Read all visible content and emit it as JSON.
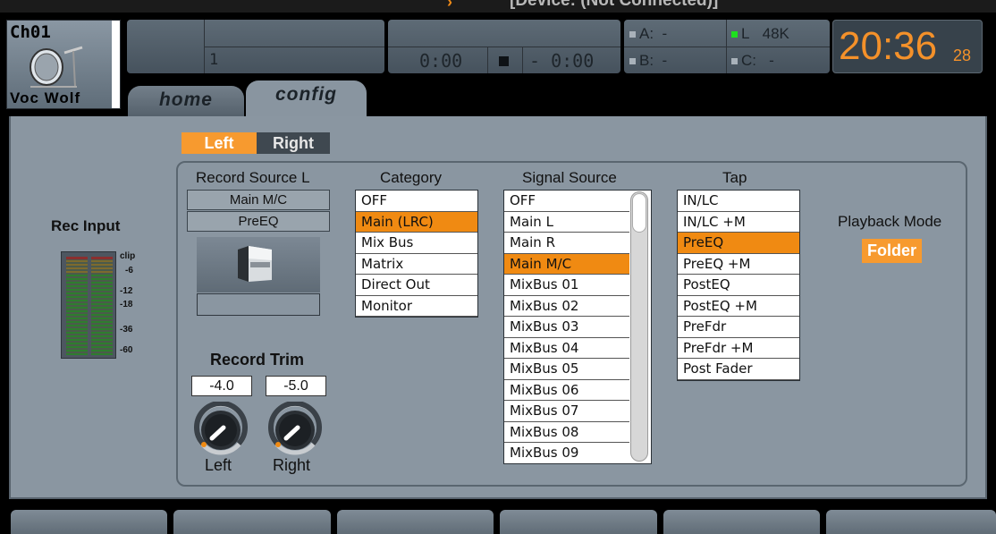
{
  "app": {
    "titlebar_text": "[Device: (Not Connected)]"
  },
  "channel": {
    "id": "Ch01",
    "name": "Voc Wolf",
    "icon": "drum-kit-icon"
  },
  "top": {
    "scene_number": "1",
    "transport": {
      "time": "0:00",
      "remaining": "- 0:00",
      "stop_icon": "stop-square-icon"
    },
    "indicators": [
      {
        "key": "A:",
        "value": "-",
        "active": false
      },
      {
        "key": "L",
        "value": "48K",
        "active": true
      },
      {
        "key": "B:",
        "value": "-",
        "active": false
      },
      {
        "key": "C:",
        "value": "-",
        "active": false
      }
    ],
    "clock": {
      "hm": "20:36",
      "sec": "28",
      "color": "#f4912a"
    }
  },
  "tabs": [
    {
      "label": "home",
      "active": false
    },
    {
      "label": "config",
      "active": true
    }
  ],
  "side_toggle": {
    "left": "Left",
    "right": "Right",
    "active": "Left"
  },
  "rec_input": {
    "title": "Rec Input",
    "scale": [
      "clip",
      "-6",
      "-12",
      "-18",
      "-36",
      "-60"
    ]
  },
  "record_source": {
    "title": "Record Source L",
    "source": "Main M/C",
    "tap": "PreEQ",
    "image_icon": "fader-knob-icon"
  },
  "category": {
    "title": "Category",
    "items": [
      "OFF",
      "Main (LRC)",
      "Mix Bus",
      "Matrix",
      "Direct Out",
      "Monitor"
    ],
    "selected": "Main (LRC)"
  },
  "signal_source": {
    "title": "Signal Source",
    "items": [
      "OFF",
      "Main L",
      "Main R",
      "Main M/C",
      "MixBus 01",
      "MixBus 02",
      "MixBus 03",
      "MixBus 04",
      "MixBus 05",
      "MixBus 06",
      "MixBus 07",
      "MixBus 08",
      "MixBus 09"
    ],
    "selected": "Main M/C"
  },
  "tap": {
    "title": "Tap",
    "items": [
      "IN/LC",
      "IN/LC +M",
      "PreEQ",
      "PreEQ +M",
      "PostEQ",
      "PostEQ +M",
      "PreFdr",
      "PreFdr +M",
      "Post Fader"
    ],
    "selected": "PreEQ"
  },
  "record_trim": {
    "title": "Record Trim",
    "left_value": "-4.0",
    "right_value": "-5.0",
    "left_label": "Left",
    "right_label": "Right"
  },
  "playback": {
    "title": "Playback Mode",
    "mode": "Folder"
  },
  "colors": {
    "accent": "#f79a2f",
    "selection": "#f08a12",
    "panel": "#8a96a1"
  }
}
